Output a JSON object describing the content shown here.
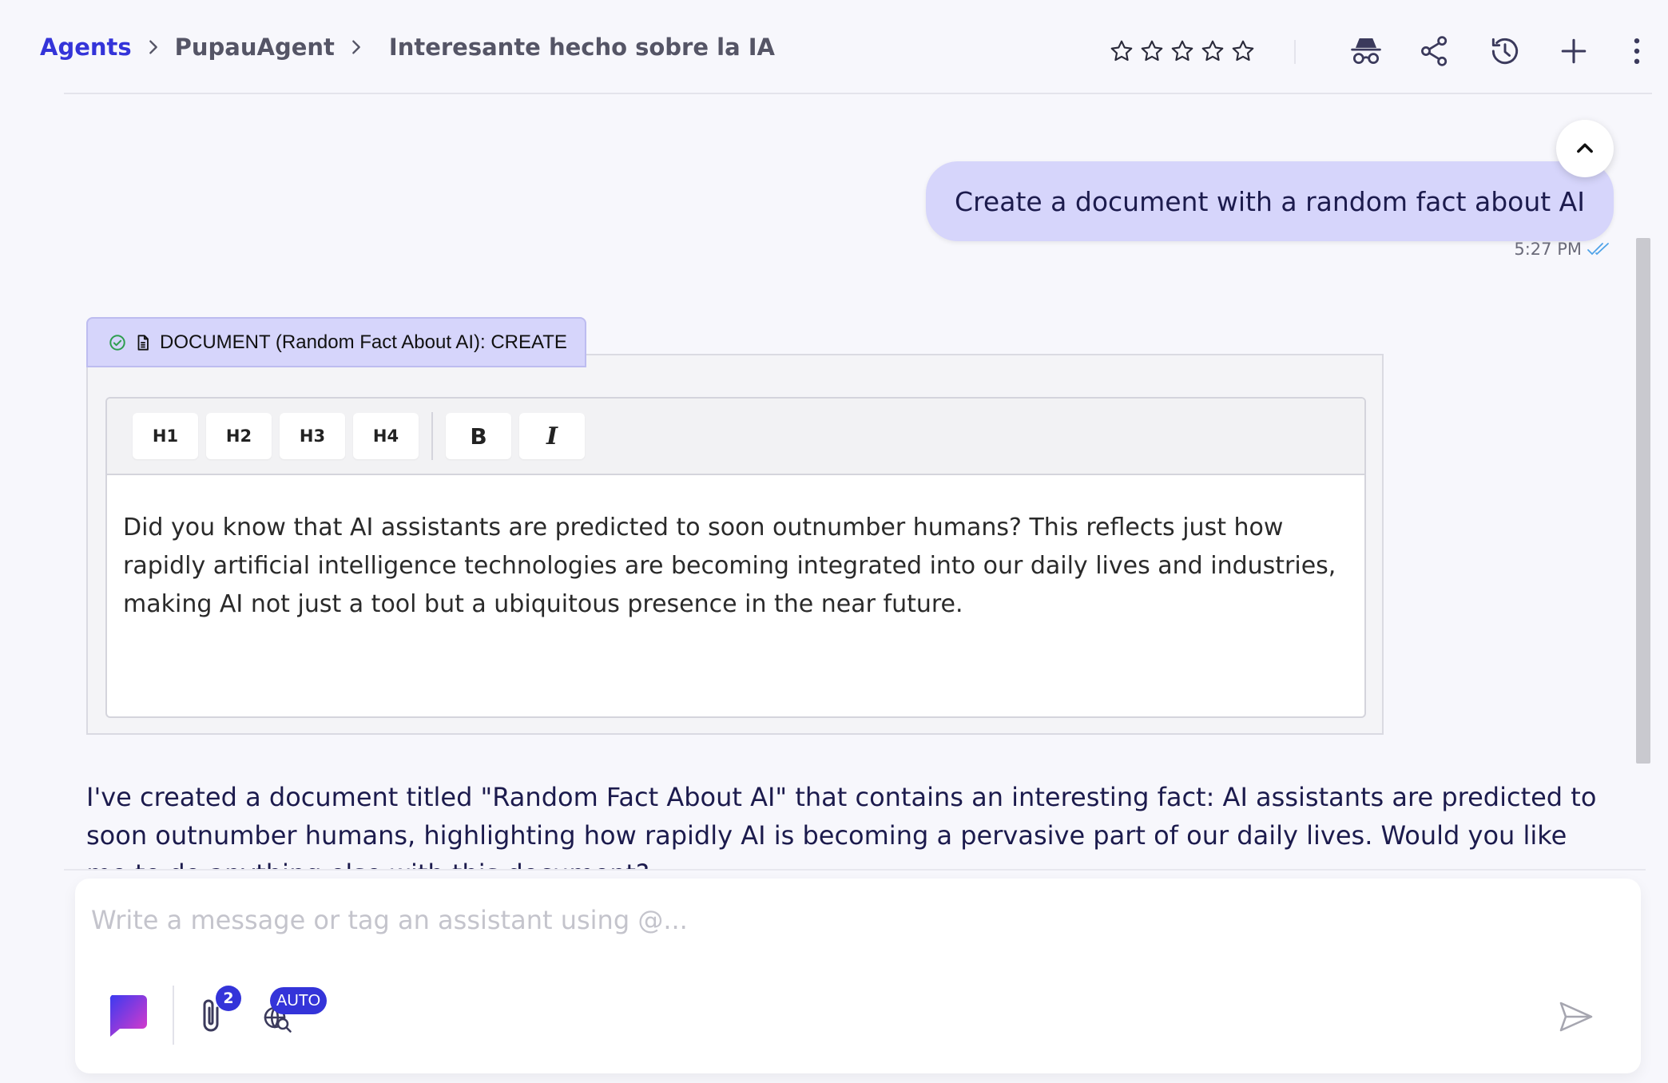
{
  "breadcrumb": {
    "root": "Agents",
    "agent": "PupauAgent",
    "conversation": "Interesante hecho sobre la IA"
  },
  "rating": {
    "stars": 5,
    "value": 0
  },
  "header_icons": [
    "incognito-icon",
    "share-icon",
    "history-icon",
    "plus-icon",
    "more-vertical-icon"
  ],
  "chat": {
    "user_message": "Create a document with a random fact about AI",
    "user_time": "5:27 PM",
    "tool_call": {
      "label": "DOCUMENT (Random Fact About AI): CREATE",
      "status": "success"
    },
    "editor": {
      "toolbar": {
        "h1": "H1",
        "h2": "H2",
        "h3": "H3",
        "h4": "H4",
        "bold": "B",
        "italic": "I"
      },
      "content": "Did you know that AI assistants are predicted to soon outnumber humans? This reflects just how rapidly artificial intelligence technologies are becoming integrated into our daily lives and industries, making AI not just a tool but a ubiquitous presence in the near future."
    },
    "assistant_message": "I've created a document titled \"Random Fact About AI\" that contains an interesting fact: AI assistants are predicted to soon outnumber humans, highlighting how rapidly AI is becoming a pervasive part of our daily lives. Would you like me to do anything else with this document?"
  },
  "composer": {
    "placeholder": "Write a message or tag an assistant using @...",
    "attachments_count": "2",
    "web_search_mode": "AUTO"
  },
  "colors": {
    "accent": "#3434d9",
    "user_bubble": "#d6d5fb",
    "text_primary": "#1c1b4d",
    "success": "#2e9e4f"
  }
}
